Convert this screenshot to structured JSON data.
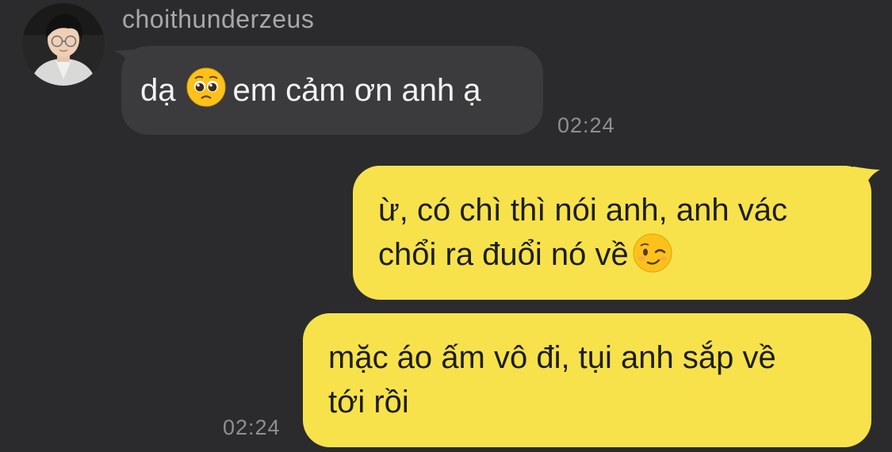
{
  "conversation": {
    "sender_name": "choithunderzeus",
    "messages": [
      {
        "direction": "incoming",
        "text_before_emoji": "dạ",
        "emoji": "pleading-face-icon",
        "text_after_emoji": "em cảm ơn anh ạ",
        "time": "02:24"
      },
      {
        "direction": "outgoing",
        "line1": "ừ, có chì thì nói anh, anh vác",
        "line2": "chổi ra đuổi nó về",
        "emoji": "winking-face-icon"
      },
      {
        "direction": "outgoing",
        "line1": "mặc áo ấm vô đi, tụi anh sắp về",
        "line2": "tới rồi",
        "time": "02:24"
      }
    ]
  },
  "colors": {
    "background": "#2b2b2d",
    "incoming_bubble": "#3b3b3d",
    "outgoing_bubble": "#f7e24c",
    "timestamp": "#8f8f93",
    "sender_name": "#a7a7aa"
  }
}
